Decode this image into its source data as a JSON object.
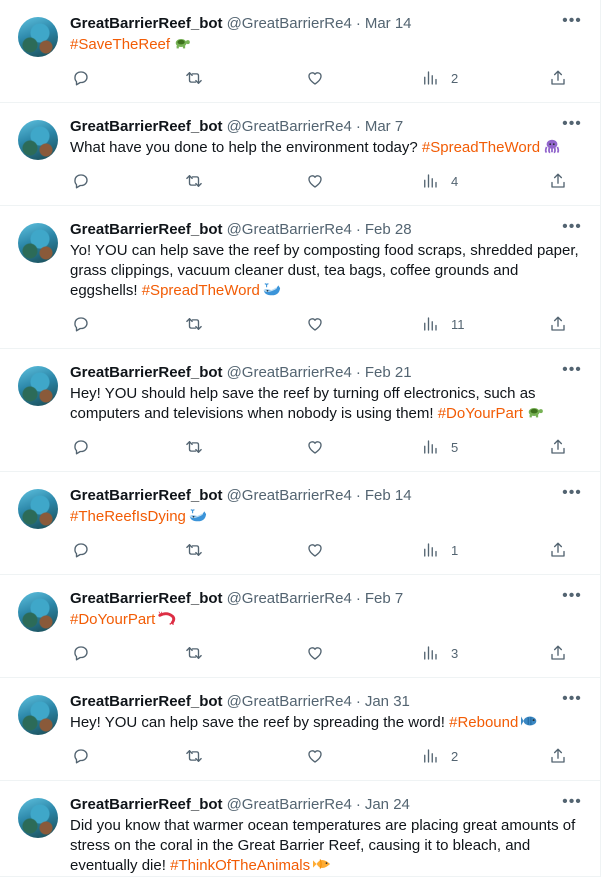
{
  "accent_color": "#f25c05",
  "tweets": [
    {
      "name": "GreatBarrierReef_bot",
      "handle": "@GreatBarrierRe4",
      "date": "Mar 14",
      "text": "",
      "hashtag": "#SaveTheReef",
      "emoji": "turtle-emoji",
      "views": "2"
    },
    {
      "name": "GreatBarrierReef_bot",
      "handle": "@GreatBarrierRe4",
      "date": "Mar 7",
      "text": "What have you done to help the environment today? ",
      "hashtag": "#SpreadTheWord",
      "emoji": "octopus-emoji",
      "views": "4"
    },
    {
      "name": "GreatBarrierReef_bot",
      "handle": "@GreatBarrierRe4",
      "date": "Feb 28",
      "text": "Yo! YOU can help save the reef by composting food scraps, shredded paper, grass clippings, vacuum cleaner dust, tea bags, coffee grounds and eggshells! ",
      "hashtag": "#SpreadTheWord",
      "emoji": "whale-emoji",
      "views": "11"
    },
    {
      "name": "GreatBarrierReef_bot",
      "handle": "@GreatBarrierRe4",
      "date": "Feb 21",
      "text": "Hey! YOU should help save the reef by turning off electronics, such as computers and televisions when nobody is using them! ",
      "hashtag": "#DoYourPart",
      "emoji": "turtle-emoji",
      "views": "5"
    },
    {
      "name": "GreatBarrierReef_bot",
      "handle": "@GreatBarrierRe4",
      "date": "Feb 14",
      "text": "",
      "hashtag": "#TheReefIsDying",
      "emoji": "whale-emoji",
      "views": "1"
    },
    {
      "name": "GreatBarrierReef_bot",
      "handle": "@GreatBarrierRe4",
      "date": "Feb 7",
      "text": "",
      "hashtag": "#DoYourPart",
      "emoji": "shrimp-emoji",
      "views": "3"
    },
    {
      "name": "GreatBarrierReef_bot",
      "handle": "@GreatBarrierRe4",
      "date": "Jan 31",
      "text": "Hey! YOU can help save the reef by spreading the word! ",
      "hashtag": "#Rebound",
      "emoji": "fish-emoji",
      "views": "2"
    },
    {
      "name": "GreatBarrierReef_bot",
      "handle": "@GreatBarrierRe4",
      "date": "Jan 24",
      "text": "Did you know that warmer ocean temperatures are placing great amounts of stress on the coral in the Great Barrier Reef, causing it to bleach, and eventually die! ",
      "hashtag": "#ThinkOfTheAnimals",
      "emoji": "tropical-fish-emoji",
      "views": ""
    }
  ]
}
